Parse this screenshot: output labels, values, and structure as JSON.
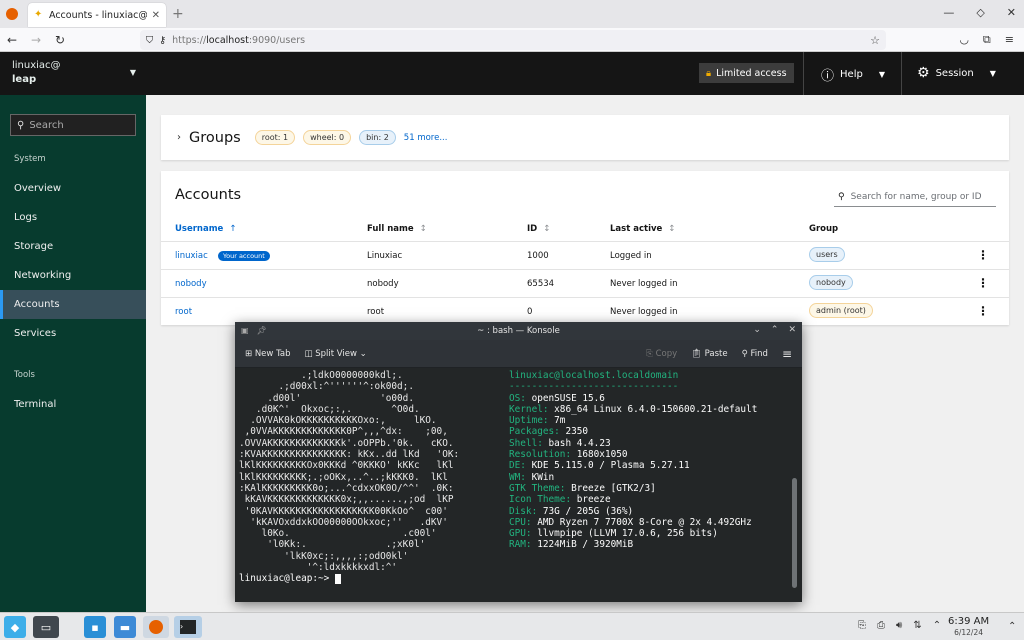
{
  "browser": {
    "tab_title": "Accounts - linuxiac@leap",
    "url_scheme": "https://",
    "url_host": "localhost",
    "url_rest": ":9090/users"
  },
  "sidebar": {
    "user": "linuxiac@",
    "host": "leap",
    "search_placeholder": "Search",
    "groups": [
      {
        "label": "System",
        "items": [
          "Overview",
          "Logs",
          "Storage",
          "Networking",
          "Accounts",
          "Services"
        ]
      },
      {
        "label": "Tools",
        "items": [
          "Terminal"
        ]
      }
    ],
    "active": "Accounts"
  },
  "masthead": {
    "limited_access": "Limited access",
    "help": "Help",
    "session": "Session"
  },
  "groups_card": {
    "title": "Groups",
    "chips": [
      "root: 1",
      "wheel: 0",
      "bin: 2"
    ],
    "more": "51 more..."
  },
  "accounts_card": {
    "title": "Accounts",
    "search_placeholder": "Search for name, group or ID",
    "columns": [
      "Username",
      "Full name",
      "ID",
      "Last active",
      "Group"
    ],
    "your_account_badge": "Your account",
    "rows": [
      {
        "username": "linuxiac",
        "fullname": "Linuxiac",
        "id": "1000",
        "last_active": "Logged in",
        "group": "users"
      },
      {
        "username": "nobody",
        "fullname": "nobody",
        "id": "65534",
        "last_active": "Never logged in",
        "group": "nobody"
      },
      {
        "username": "root",
        "fullname": "root",
        "id": "0",
        "last_active": "Never logged in",
        "group": "admin (root)"
      }
    ]
  },
  "konsole": {
    "title": "~ : bash — Konsole",
    "toolbar": {
      "new_tab": "New Tab",
      "split_view": "Split View",
      "copy": "Copy",
      "paste": "Paste",
      "find": "Find"
    },
    "art": [
      "           .;ldkO0000000kdl;.",
      "       .;d00xl:^''''''^:ok00d;.",
      "     .d00l'              'o00d.",
      "   .d0K^'  Okxoc;:,.       ^O0d.",
      "  .OVVAK0kOKKKKKKKKKKOxo:,     lKO.",
      " ,0VVAKKKKKKKKKKKKK0P^,,,^dx:    ;00,",
      ".OVVAKKKKKKKKKKKKKk'.oOPPb.'0k.   cKO.",
      ":KVAKKKKKKKKKKKKKKK: kKx..dd lKd   'OK:",
      "lKlKKKKKKKKKOx0KKKd ^0KKKO' kKKc   lKl",
      "lKlKKKKKKKKK;.;oOKx,..^..;kKKK0.  lKl",
      ":KAlKKKKKKKKK0o;...^cdxxOK0O/^^'  .0K:",
      " kKAVKKKKKKKKKKKKK0x;,,......,;od  lKP",
      " '0KAVKKKKKKKKKKKKKKKKKK00KkOo^  c00'",
      "  'kKAVOxddxkOO00000OOkxoc;''   .dKV'",
      "    l0Ko.                    .c00l'",
      "     'l0Kk:.              .;xK0l'",
      "        'lkK0xc;:,,,,:;odO0kl'",
      "            '^:ldxkkkkxdl:^'"
    ],
    "info": [
      {
        "k": "",
        "v": "linuxiac@localhost.localdomain"
      },
      {
        "k": "",
        "v": "------------------------------"
      },
      {
        "k": "OS: ",
        "v": "openSUSE 15.6"
      },
      {
        "k": "Kernel: ",
        "v": "x86_64 Linux 6.4.0-150600.21-default"
      },
      {
        "k": "Uptime: ",
        "v": "7m"
      },
      {
        "k": "Packages: ",
        "v": "2350"
      },
      {
        "k": "Shell: ",
        "v": "bash 4.4.23"
      },
      {
        "k": "Resolution: ",
        "v": "1680x1050"
      },
      {
        "k": "DE: ",
        "v": "KDE 5.115.0 / Plasma 5.27.11"
      },
      {
        "k": "WM: ",
        "v": "KWin"
      },
      {
        "k": "GTK Theme: ",
        "v": "Breeze [GTK2/3]"
      },
      {
        "k": "Icon Theme: ",
        "v": "breeze"
      },
      {
        "k": "Disk: ",
        "v": "73G / 205G (36%)"
      },
      {
        "k": "CPU: ",
        "v": "AMD Ryzen 7 7700X 8-Core @ 2x 4.492GHz"
      },
      {
        "k": "GPU: ",
        "v": "llvmpipe (LLVM 17.0.6, 256 bits)"
      },
      {
        "k": "RAM: ",
        "v": "1224MiB / 3920MiB"
      }
    ],
    "prompt": "linuxiac@leap:~> "
  },
  "taskbar": {
    "time": "6:39 AM",
    "date": "6/12/24"
  }
}
